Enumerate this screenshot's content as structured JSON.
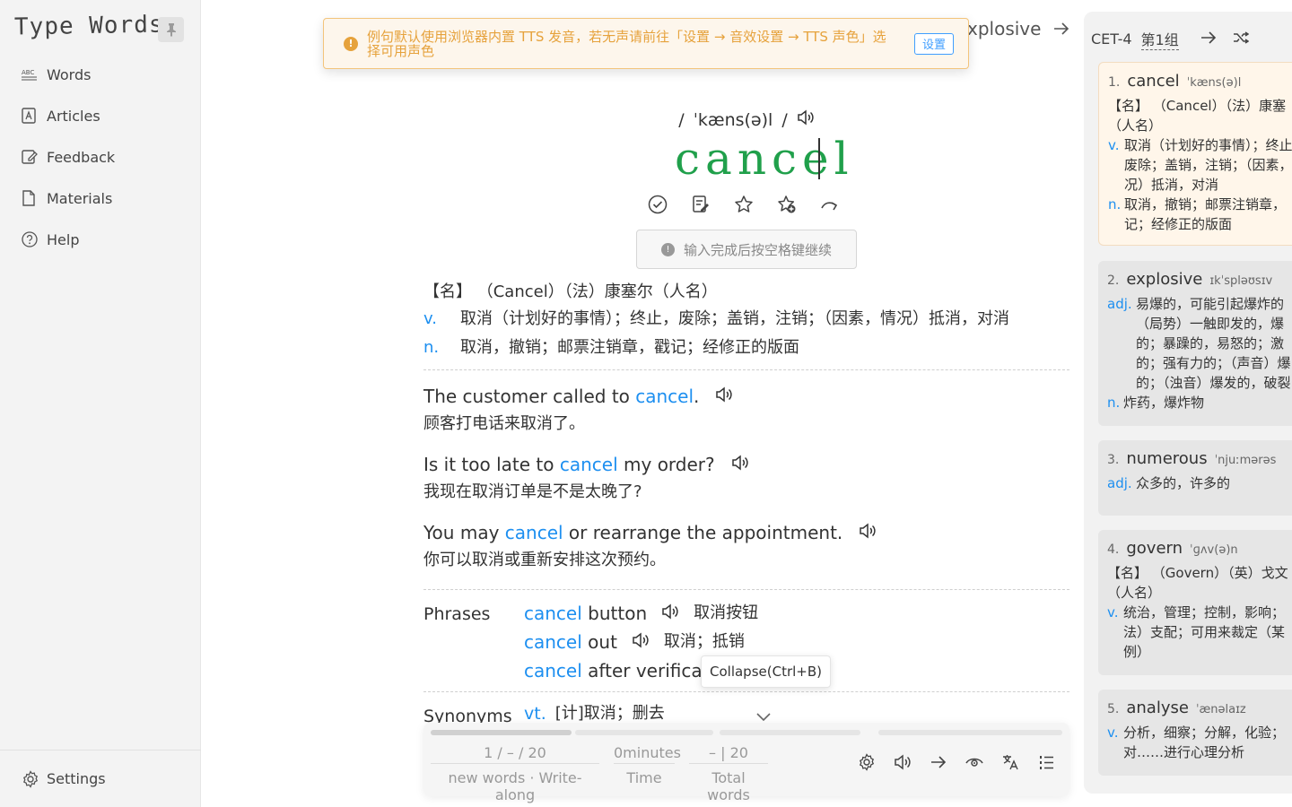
{
  "app": {
    "logo": "Type Words"
  },
  "sidebar": {
    "items": [
      {
        "label": "Words",
        "icon": "abc-icon"
      },
      {
        "label": "Articles",
        "icon": "article-icon"
      },
      {
        "label": "Feedback",
        "icon": "feedback-icon"
      },
      {
        "label": "Materials",
        "icon": "document-icon"
      },
      {
        "label": "Help",
        "icon": "help-icon"
      }
    ],
    "settings_label": "Settings"
  },
  "toast": {
    "text": "例句默认使用浏览器内置 TTS 发音，若无声请前往「设置 → 音效设置 → TTS 声色」选择可用声色",
    "button": "设置"
  },
  "next_word": {
    "label": "xplosive"
  },
  "word": {
    "phonetic_left": "/",
    "phonetic": "ˈkæns(ə)l",
    "phonetic_right": "/",
    "text": "cancel",
    "hint": "输入完成后按空格键继续"
  },
  "definitions": [
    {
      "pos": "",
      "text": "【名】 （Cancel）（法）康塞尔（人名）"
    },
    {
      "pos": "v.",
      "text": "取消（计划好的事情）；终止，废除；盖销，注销；（因素，情况）抵消，对消"
    },
    {
      "pos": "n.",
      "text": "取消，撤销；邮票注销章，戳记；经修正的版面"
    }
  ],
  "examples": [
    {
      "pre": "The customer called to ",
      "hl": "cancel",
      "post": ".",
      "zh": "顾客打电话来取消了。"
    },
    {
      "pre": "Is it too late to ",
      "hl": "cancel",
      "post": " my order?",
      "zh": "我现在取消订单是不是太晚了?"
    },
    {
      "pre": "You may ",
      "hl": "cancel",
      "post": " or rearrange the appointment.",
      "zh": "你可以取消或重新安排这次预约。"
    }
  ],
  "phrases": {
    "title": "Phrases",
    "items": [
      {
        "hl": "cancel",
        "rest": " button",
        "zh": "取消按钮"
      },
      {
        "hl": "cancel",
        "rest": " out",
        "zh": "取消；抵销"
      },
      {
        "hl": "cancel",
        "rest": " after verifica",
        "zh": ""
      }
    ]
  },
  "tooltip": "Collapse(Ctrl+B)",
  "synonyms": {
    "title": "Synonyms",
    "pos": "vt.",
    "text": "[计]取消；删去"
  },
  "stats": {
    "progress": [
      0.24,
      0,
      0,
      0
    ],
    "count_text": "1 / – / 20",
    "count_label": "new words · Write-along",
    "time_value": "0minutes",
    "time_label": "Time",
    "total_value": "– | 20",
    "total_label": "Total words"
  },
  "panel": {
    "book": "CET-4",
    "group": "第1组",
    "cards": [
      {
        "idx": "1.",
        "word": "cancel",
        "ph": "ˈkæns(ə)l",
        "lines": [
          {
            "pos": "",
            "text": "【名】 （Cancel）（法）康塞"
          },
          {
            "pos": "",
            "text": "（人名）"
          },
          {
            "pos": "v.",
            "text": "取消（计划好的事情）；终止"
          },
          {
            "pos": "",
            "text": "废除；盖销，注销；（因素，"
          },
          {
            "pos": "",
            "text": "况）抵消，对消"
          },
          {
            "pos": "n.",
            "text": "取消，撤销；邮票注销章，"
          },
          {
            "pos": "",
            "text": "记；经修正的版面"
          }
        ]
      },
      {
        "idx": "2.",
        "word": "explosive",
        "ph": "ɪkˈspləʊsɪv",
        "lines": [
          {
            "pos": "adj.",
            "text": "易爆的，可能引起爆炸的"
          },
          {
            "pos": "",
            "text": "（局势）一触即发的，爆"
          },
          {
            "pos": "",
            "text": "的；暴躁的，易怒的；激"
          },
          {
            "pos": "",
            "text": "的；强有力的；（声音）爆"
          },
          {
            "pos": "",
            "text": "的；（浊音）爆发的，破裂"
          },
          {
            "pos": "n.",
            "text": "炸药，爆炸物"
          }
        ]
      },
      {
        "idx": "3.",
        "word": "numerous",
        "ph": "ˈnjuːmərəs",
        "lines": [
          {
            "pos": "adj.",
            "text": "众多的，许多的"
          }
        ]
      },
      {
        "idx": "4.",
        "word": "govern",
        "ph": "ˈɡʌv(ə)n",
        "lines": [
          {
            "pos": "",
            "text": "【名】 （Govern）（英）戈文"
          },
          {
            "pos": "",
            "text": "（人名）"
          },
          {
            "pos": "v.",
            "text": "统治，管理；控制，影响；"
          },
          {
            "pos": "",
            "text": "法）支配；可用来裁定（某"
          },
          {
            "pos": "",
            "text": "例）"
          }
        ]
      },
      {
        "idx": "5.",
        "word": "analyse",
        "ph": "ˈænəlaɪz",
        "lines": [
          {
            "pos": "v.",
            "text": "分析，细察；分解，化验；"
          },
          {
            "pos": "",
            "text": "对……进行心理分析"
          }
        ]
      }
    ]
  }
}
